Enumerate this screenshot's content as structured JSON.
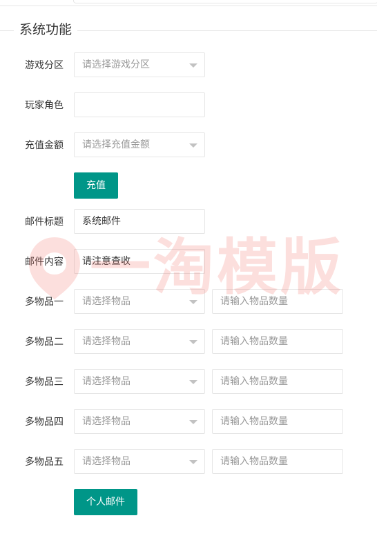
{
  "legend": "系统功能",
  "zone": {
    "label": "游戏分区",
    "placeholder": "请选择游戏分区"
  },
  "role": {
    "label": "玩家角色",
    "value": ""
  },
  "amount": {
    "label": "充值金额",
    "placeholder": "请选择充值金额"
  },
  "recharge_button": "充值",
  "mail_title": {
    "label": "邮件标题",
    "value": "系统邮件"
  },
  "mail_content": {
    "label": "邮件内容",
    "value": "请注意查收"
  },
  "items": [
    {
      "label": "多物品一",
      "item_placeholder": "请选择物品",
      "qty_placeholder": "请输入物品数量"
    },
    {
      "label": "多物品二",
      "item_placeholder": "请选择物品",
      "qty_placeholder": "请输入物品数量"
    },
    {
      "label": "多物品三",
      "item_placeholder": "请选择物品",
      "qty_placeholder": "请输入物品数量"
    },
    {
      "label": "多物品四",
      "item_placeholder": "请选择物品",
      "qty_placeholder": "请输入物品数量"
    },
    {
      "label": "多物品五",
      "item_placeholder": "请选择物品",
      "qty_placeholder": "请输入物品数量"
    }
  ],
  "personal_mail_button": "个人邮件",
  "watermark": "一淘模版",
  "colors": {
    "primary": "#009688",
    "border": "#e6e6e6",
    "placeholder": "#999999",
    "watermark": "#f06e64"
  },
  "icons": {
    "dropdown": "chevron-down-icon",
    "logo": "watermark-logo-icon"
  }
}
